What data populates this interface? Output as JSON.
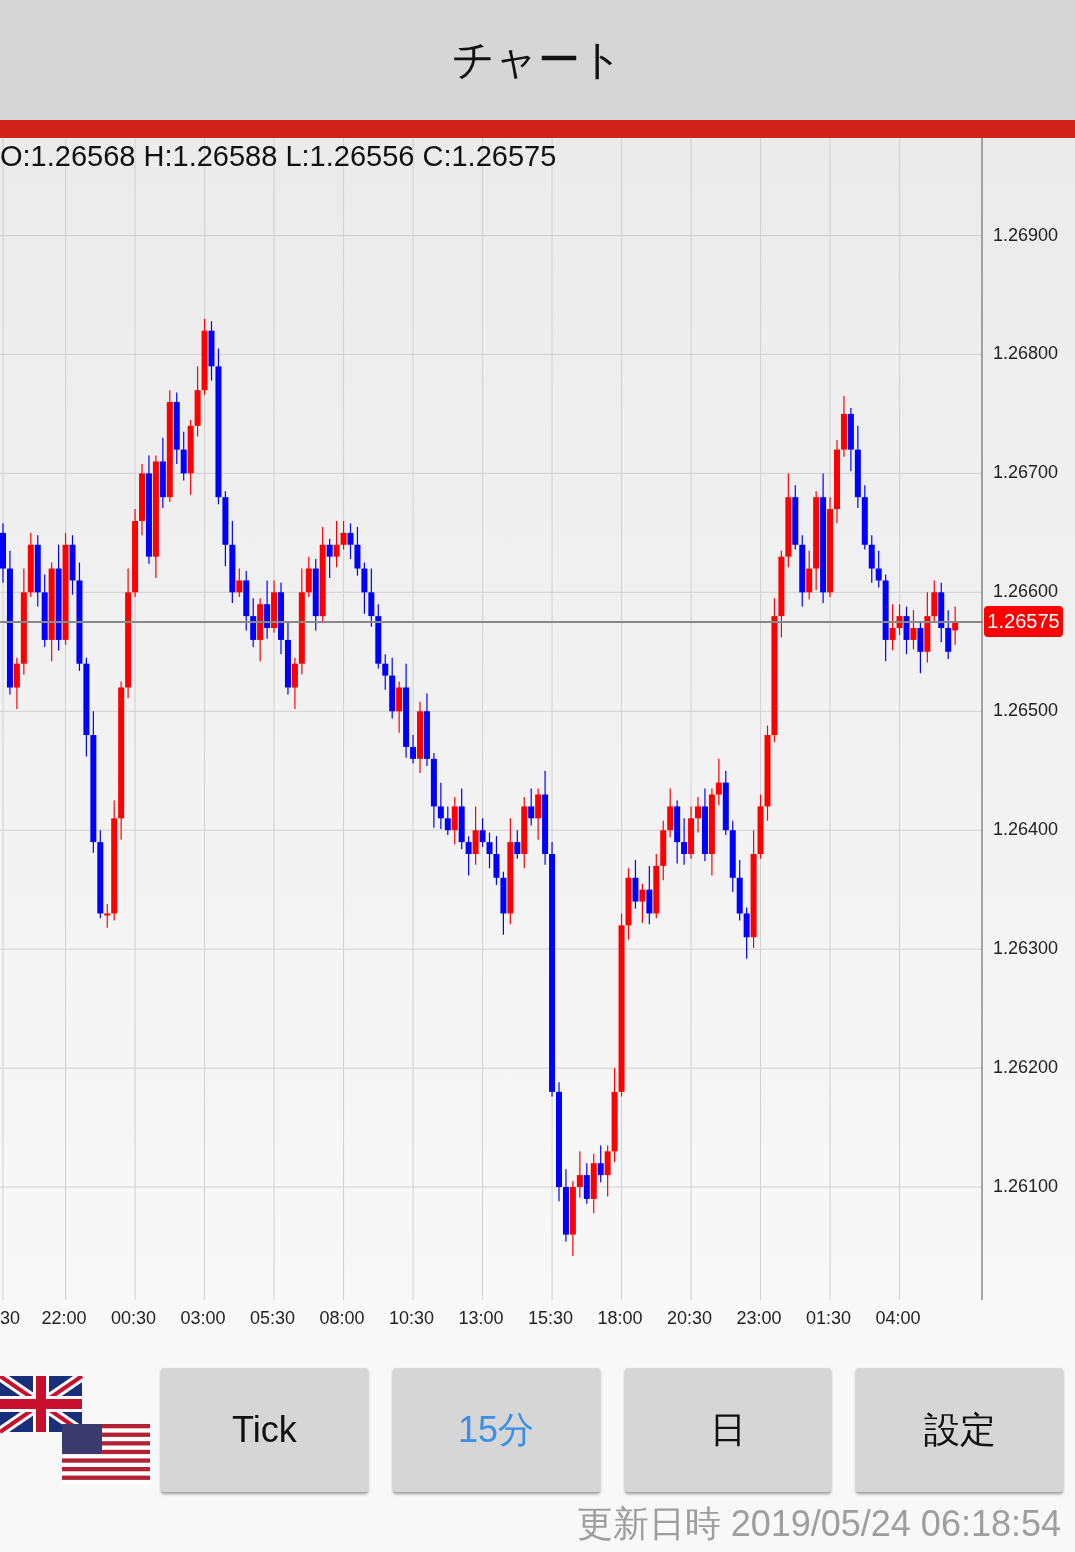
{
  "header": {
    "title": "チャート"
  },
  "chart": {
    "ohlc_readout": "O:1.26568 H:1.26588 L:1.26556 C:1.26575",
    "current_price": "1.26575",
    "chart_data": {
      "type": "candlestick",
      "categories": [
        "30",
        null,
        null,
        null,
        null,
        null,
        null,
        null,
        null,
        "22:00",
        null,
        null,
        null,
        null,
        null,
        null,
        null,
        null,
        null,
        "00:30",
        null,
        null,
        null,
        null,
        null,
        null,
        null,
        null,
        null,
        "03:00",
        null,
        null,
        null,
        null,
        null,
        null,
        null,
        null,
        null,
        "05:30",
        null,
        null,
        null,
        null,
        null,
        null,
        null,
        null,
        null,
        "08:00",
        null,
        null,
        null,
        null,
        null,
        null,
        null,
        null,
        null,
        "10:30",
        null,
        null,
        null,
        null,
        null,
        null,
        null,
        null,
        null,
        "13:00",
        null,
        null,
        null,
        null,
        null,
        null,
        null,
        null,
        null,
        "15:30",
        null,
        null,
        null,
        null,
        null,
        null,
        null,
        null,
        null,
        "18:00",
        null,
        null,
        null,
        null,
        null,
        null,
        null,
        null,
        null,
        "20:30",
        null,
        null,
        null,
        null,
        null,
        null,
        null,
        null,
        null,
        "23:00",
        null,
        null,
        null,
        null,
        null,
        null,
        null,
        null,
        null,
        "01:30",
        null,
        null,
        null,
        null,
        null,
        null,
        null,
        null,
        null,
        "04:00",
        null,
        null,
        null,
        null,
        null,
        null,
        null,
        null
      ],
      "ylim": [
        1.26005,
        1.26982
      ],
      "grid": true,
      "ref_lines": [
        {
          "axis": "y",
          "value": 1.26575
        }
      ],
      "yticks": [
        {
          "value": 1.269,
          "label": "1.26900"
        },
        {
          "value": 1.268,
          "label": "1.26800"
        },
        {
          "value": 1.267,
          "label": "1.26700"
        },
        {
          "value": 1.266,
          "label": "1.26600"
        },
        {
          "value": 1.265,
          "label": "1.26500"
        },
        {
          "value": 1.264,
          "label": "1.26400"
        },
        {
          "value": 1.263,
          "label": "1.26300"
        },
        {
          "value": 1.262,
          "label": "1.26200"
        },
        {
          "value": 1.261,
          "label": "1.26100"
        }
      ],
      "ohlc": [
        [
          1.2665,
          1.26658,
          1.26608,
          1.2662
        ],
        [
          1.2662,
          1.26635,
          1.26514,
          1.2652
        ],
        [
          1.2652,
          1.26545,
          1.26502,
          1.2654
        ],
        [
          1.2654,
          1.2662,
          1.26531,
          1.266
        ],
        [
          1.266,
          1.2665,
          1.26596,
          1.2664
        ],
        [
          1.2664,
          1.26648,
          1.26588,
          1.266
        ],
        [
          1.266,
          1.26615,
          1.26554,
          1.2656
        ],
        [
          1.2656,
          1.26625,
          1.26542,
          1.2662
        ],
        [
          1.2662,
          1.2664,
          1.26551,
          1.2656
        ],
        [
          1.2656,
          1.2665,
          1.26556,
          1.2664
        ],
        [
          1.2664,
          1.26648,
          1.26598,
          1.2661
        ],
        [
          1.2661,
          1.26625,
          1.26534,
          1.2654
        ],
        [
          1.2654,
          1.26545,
          1.26462,
          1.2648
        ],
        [
          1.2648,
          1.265,
          1.26381,
          1.2639
        ],
        [
          1.2639,
          1.264,
          1.26326,
          1.2633
        ],
        [
          1.2633,
          1.26338,
          1.26318,
          1.2633
        ],
        [
          1.2633,
          1.26425,
          1.26324,
          1.2641
        ],
        [
          1.2641,
          1.26525,
          1.26392,
          1.2652
        ],
        [
          1.2652,
          1.2662,
          1.26511,
          1.266
        ],
        [
          1.266,
          1.2667,
          1.26596,
          1.2666
        ],
        [
          1.2666,
          1.26708,
          1.26648,
          1.267
        ],
        [
          1.267,
          1.26715,
          1.26624,
          1.2663
        ],
        [
          1.2663,
          1.26715,
          1.26612,
          1.2671
        ],
        [
          1.2671,
          1.2673,
          1.26671,
          1.2668
        ],
        [
          1.2668,
          1.2677,
          1.26676,
          1.2676
        ],
        [
          1.2676,
          1.26768,
          1.26708,
          1.2672
        ],
        [
          1.2672,
          1.26735,
          1.26694,
          1.267
        ],
        [
          1.267,
          1.26745,
          1.26682,
          1.2674
        ],
        [
          1.2674,
          1.2679,
          1.26731,
          1.2677
        ],
        [
          1.2677,
          1.2683,
          1.26766,
          1.2682
        ],
        [
          1.2682,
          1.26828,
          1.26778,
          1.2679
        ],
        [
          1.2679,
          1.26805,
          1.26674,
          1.2668
        ],
        [
          1.2668,
          1.26685,
          1.26622,
          1.2664
        ],
        [
          1.2664,
          1.2666,
          1.26591,
          1.266
        ],
        [
          1.266,
          1.2662,
          1.26596,
          1.2661
        ],
        [
          1.2661,
          1.26618,
          1.26568,
          1.2658
        ],
        [
          1.2658,
          1.26595,
          1.26554,
          1.2656
        ],
        [
          1.2656,
          1.26595,
          1.26542,
          1.2659
        ],
        [
          1.2659,
          1.2661,
          1.26561,
          1.2657
        ],
        [
          1.2657,
          1.2661,
          1.26566,
          1.266
        ],
        [
          1.266,
          1.26608,
          1.26548,
          1.2656
        ],
        [
          1.2656,
          1.26575,
          1.26514,
          1.2652
        ],
        [
          1.2652,
          1.26545,
          1.26502,
          1.2654
        ],
        [
          1.2654,
          1.2662,
          1.26531,
          1.266
        ],
        [
          1.266,
          1.2663,
          1.26596,
          1.2662
        ],
        [
          1.2662,
          1.26628,
          1.26568,
          1.2658
        ],
        [
          1.2658,
          1.26655,
          1.26574,
          1.2664
        ],
        [
          1.2664,
          1.26645,
          1.26612,
          1.2663
        ],
        [
          1.2663,
          1.2666,
          1.26621,
          1.2664
        ],
        [
          1.2664,
          1.2666,
          1.26636,
          1.2665
        ],
        [
          1.2665,
          1.26658,
          1.26628,
          1.2664
        ],
        [
          1.2664,
          1.26655,
          1.26614,
          1.2662
        ],
        [
          1.2662,
          1.26625,
          1.26582,
          1.266
        ],
        [
          1.266,
          1.2662,
          1.26571,
          1.2658
        ],
        [
          1.2658,
          1.2659,
          1.26536,
          1.2654
        ],
        [
          1.2654,
          1.26548,
          1.26518,
          1.2653
        ],
        [
          1.2653,
          1.26545,
          1.26494,
          1.265
        ],
        [
          1.265,
          1.26525,
          1.26482,
          1.2652
        ],
        [
          1.2652,
          1.2654,
          1.26461,
          1.2647
        ],
        [
          1.2647,
          1.2648,
          1.26456,
          1.2646
        ],
        [
          1.2646,
          1.26508,
          1.26448,
          1.265
        ],
        [
          1.265,
          1.26515,
          1.26454,
          1.2646
        ],
        [
          1.2646,
          1.26465,
          1.26402,
          1.2642
        ],
        [
          1.2642,
          1.2644,
          1.26401,
          1.2641
        ],
        [
          1.2641,
          1.2642,
          1.26396,
          1.264
        ],
        [
          1.264,
          1.26428,
          1.26388,
          1.2642
        ],
        [
          1.2642,
          1.26435,
          1.26384,
          1.2639
        ],
        [
          1.2639,
          1.26395,
          1.26362,
          1.2638
        ],
        [
          1.2638,
          1.2642,
          1.26371,
          1.264
        ],
        [
          1.264,
          1.2641,
          1.26386,
          1.2639
        ],
        [
          1.2639,
          1.26398,
          1.26368,
          1.2638
        ],
        [
          1.2638,
          1.26395,
          1.26354,
          1.2636
        ],
        [
          1.2636,
          1.26365,
          1.26312,
          1.2633
        ],
        [
          1.2633,
          1.2641,
          1.26321,
          1.2639
        ],
        [
          1.2639,
          1.264,
          1.26376,
          1.2638
        ],
        [
          1.2638,
          1.26428,
          1.26368,
          1.2642
        ],
        [
          1.2642,
          1.26435,
          1.26404,
          1.2641
        ],
        [
          1.2641,
          1.26435,
          1.26392,
          1.2643
        ],
        [
          1.2643,
          1.2645,
          1.26371,
          1.2638
        ],
        [
          1.2638,
          1.2639,
          1.26176,
          1.2618
        ],
        [
          1.2618,
          1.26188,
          1.26088,
          1.261
        ],
        [
          1.261,
          1.26115,
          1.26054,
          1.2606
        ],
        [
          1.2606,
          1.26105,
          1.26042,
          1.261
        ],
        [
          1.261,
          1.2613,
          1.26091,
          1.2611
        ],
        [
          1.2611,
          1.2612,
          1.26086,
          1.2609
        ],
        [
          1.2609,
          1.26128,
          1.26078,
          1.2612
        ],
        [
          1.2612,
          1.26135,
          1.26104,
          1.2611
        ],
        [
          1.2611,
          1.26135,
          1.26092,
          1.2613
        ],
        [
          1.2613,
          1.262,
          1.26121,
          1.2618
        ],
        [
          1.2618,
          1.2633,
          1.26176,
          1.2632
        ],
        [
          1.2632,
          1.26368,
          1.26308,
          1.2636
        ],
        [
          1.2636,
          1.26375,
          1.26334,
          1.2634
        ],
        [
          1.2634,
          1.26355,
          1.26322,
          1.2635
        ],
        [
          1.2635,
          1.2637,
          1.26321,
          1.2633
        ],
        [
          1.2633,
          1.2638,
          1.26326,
          1.2637
        ],
        [
          1.2637,
          1.26408,
          1.26358,
          1.264
        ],
        [
          1.264,
          1.26435,
          1.26394,
          1.2642
        ],
        [
          1.2642,
          1.26425,
          1.26372,
          1.2639
        ],
        [
          1.2639,
          1.2641,
          1.26371,
          1.2638
        ],
        [
          1.2638,
          1.2642,
          1.26376,
          1.2641
        ],
        [
          1.2641,
          1.26428,
          1.26398,
          1.2642
        ],
        [
          1.2642,
          1.26435,
          1.26374,
          1.2638
        ],
        [
          1.2638,
          1.26435,
          1.26362,
          1.2643
        ],
        [
          1.2643,
          1.2646,
          1.26421,
          1.2644
        ],
        [
          1.2644,
          1.2645,
          1.26396,
          1.264
        ],
        [
          1.264,
          1.26408,
          1.26348,
          1.2636
        ],
        [
          1.2636,
          1.26375,
          1.26324,
          1.2633
        ],
        [
          1.2633,
          1.26335,
          1.26292,
          1.2631
        ],
        [
          1.2631,
          1.264,
          1.26301,
          1.2638
        ],
        [
          1.2638,
          1.2643,
          1.26376,
          1.2642
        ],
        [
          1.2642,
          1.26488,
          1.26408,
          1.2648
        ],
        [
          1.2648,
          1.26595,
          1.26474,
          1.2658
        ],
        [
          1.2658,
          1.26635,
          1.26562,
          1.2663
        ],
        [
          1.2663,
          1.267,
          1.26621,
          1.2668
        ],
        [
          1.2668,
          1.2669,
          1.26636,
          1.2664
        ],
        [
          1.2664,
          1.26648,
          1.26588,
          1.266
        ],
        [
          1.266,
          1.26635,
          1.26594,
          1.2662
        ],
        [
          1.2662,
          1.26685,
          1.26602,
          1.2668
        ],
        [
          1.2668,
          1.267,
          1.26591,
          1.266
        ],
        [
          1.266,
          1.2668,
          1.26596,
          1.2667
        ],
        [
          1.2667,
          1.26728,
          1.26658,
          1.2672
        ],
        [
          1.2672,
          1.26765,
          1.26714,
          1.2675
        ],
        [
          1.2675,
          1.26755,
          1.26702,
          1.2672
        ],
        [
          1.2672,
          1.2674,
          1.26671,
          1.2668
        ],
        [
          1.2668,
          1.2669,
          1.26636,
          1.2664
        ],
        [
          1.2664,
          1.26648,
          1.26608,
          1.2662
        ],
        [
          1.2662,
          1.26635,
          1.26604,
          1.2661
        ],
        [
          1.2661,
          1.26615,
          1.26542,
          1.2656
        ],
        [
          1.2656,
          1.2659,
          1.26551,
          1.2657
        ],
        [
          1.2657,
          1.2659,
          1.26564,
          1.2658
        ],
        [
          1.2658,
          1.26588,
          1.26548,
          1.2656
        ],
        [
          1.2656,
          1.26585,
          1.26552,
          1.2657
        ],
        [
          1.2657,
          1.26575,
          1.26532,
          1.2655
        ],
        [
          1.2655,
          1.266,
          1.26541,
          1.2658
        ],
        [
          1.2658,
          1.2661,
          1.26576,
          1.266
        ],
        [
          1.266,
          1.26608,
          1.26558,
          1.2657
        ],
        [
          1.2657,
          1.26585,
          1.26544,
          1.2655
        ],
        [
          1.26568,
          1.26588,
          1.26556,
          1.26575
        ]
      ]
    }
  },
  "buttons": [
    {
      "label": "Tick",
      "selected": false
    },
    {
      "label": "15分",
      "selected": true
    },
    {
      "label": "日",
      "selected": false
    },
    {
      "label": "設定",
      "selected": false
    }
  ],
  "updated": "更新日時 2019/05/24 06:18:54"
}
